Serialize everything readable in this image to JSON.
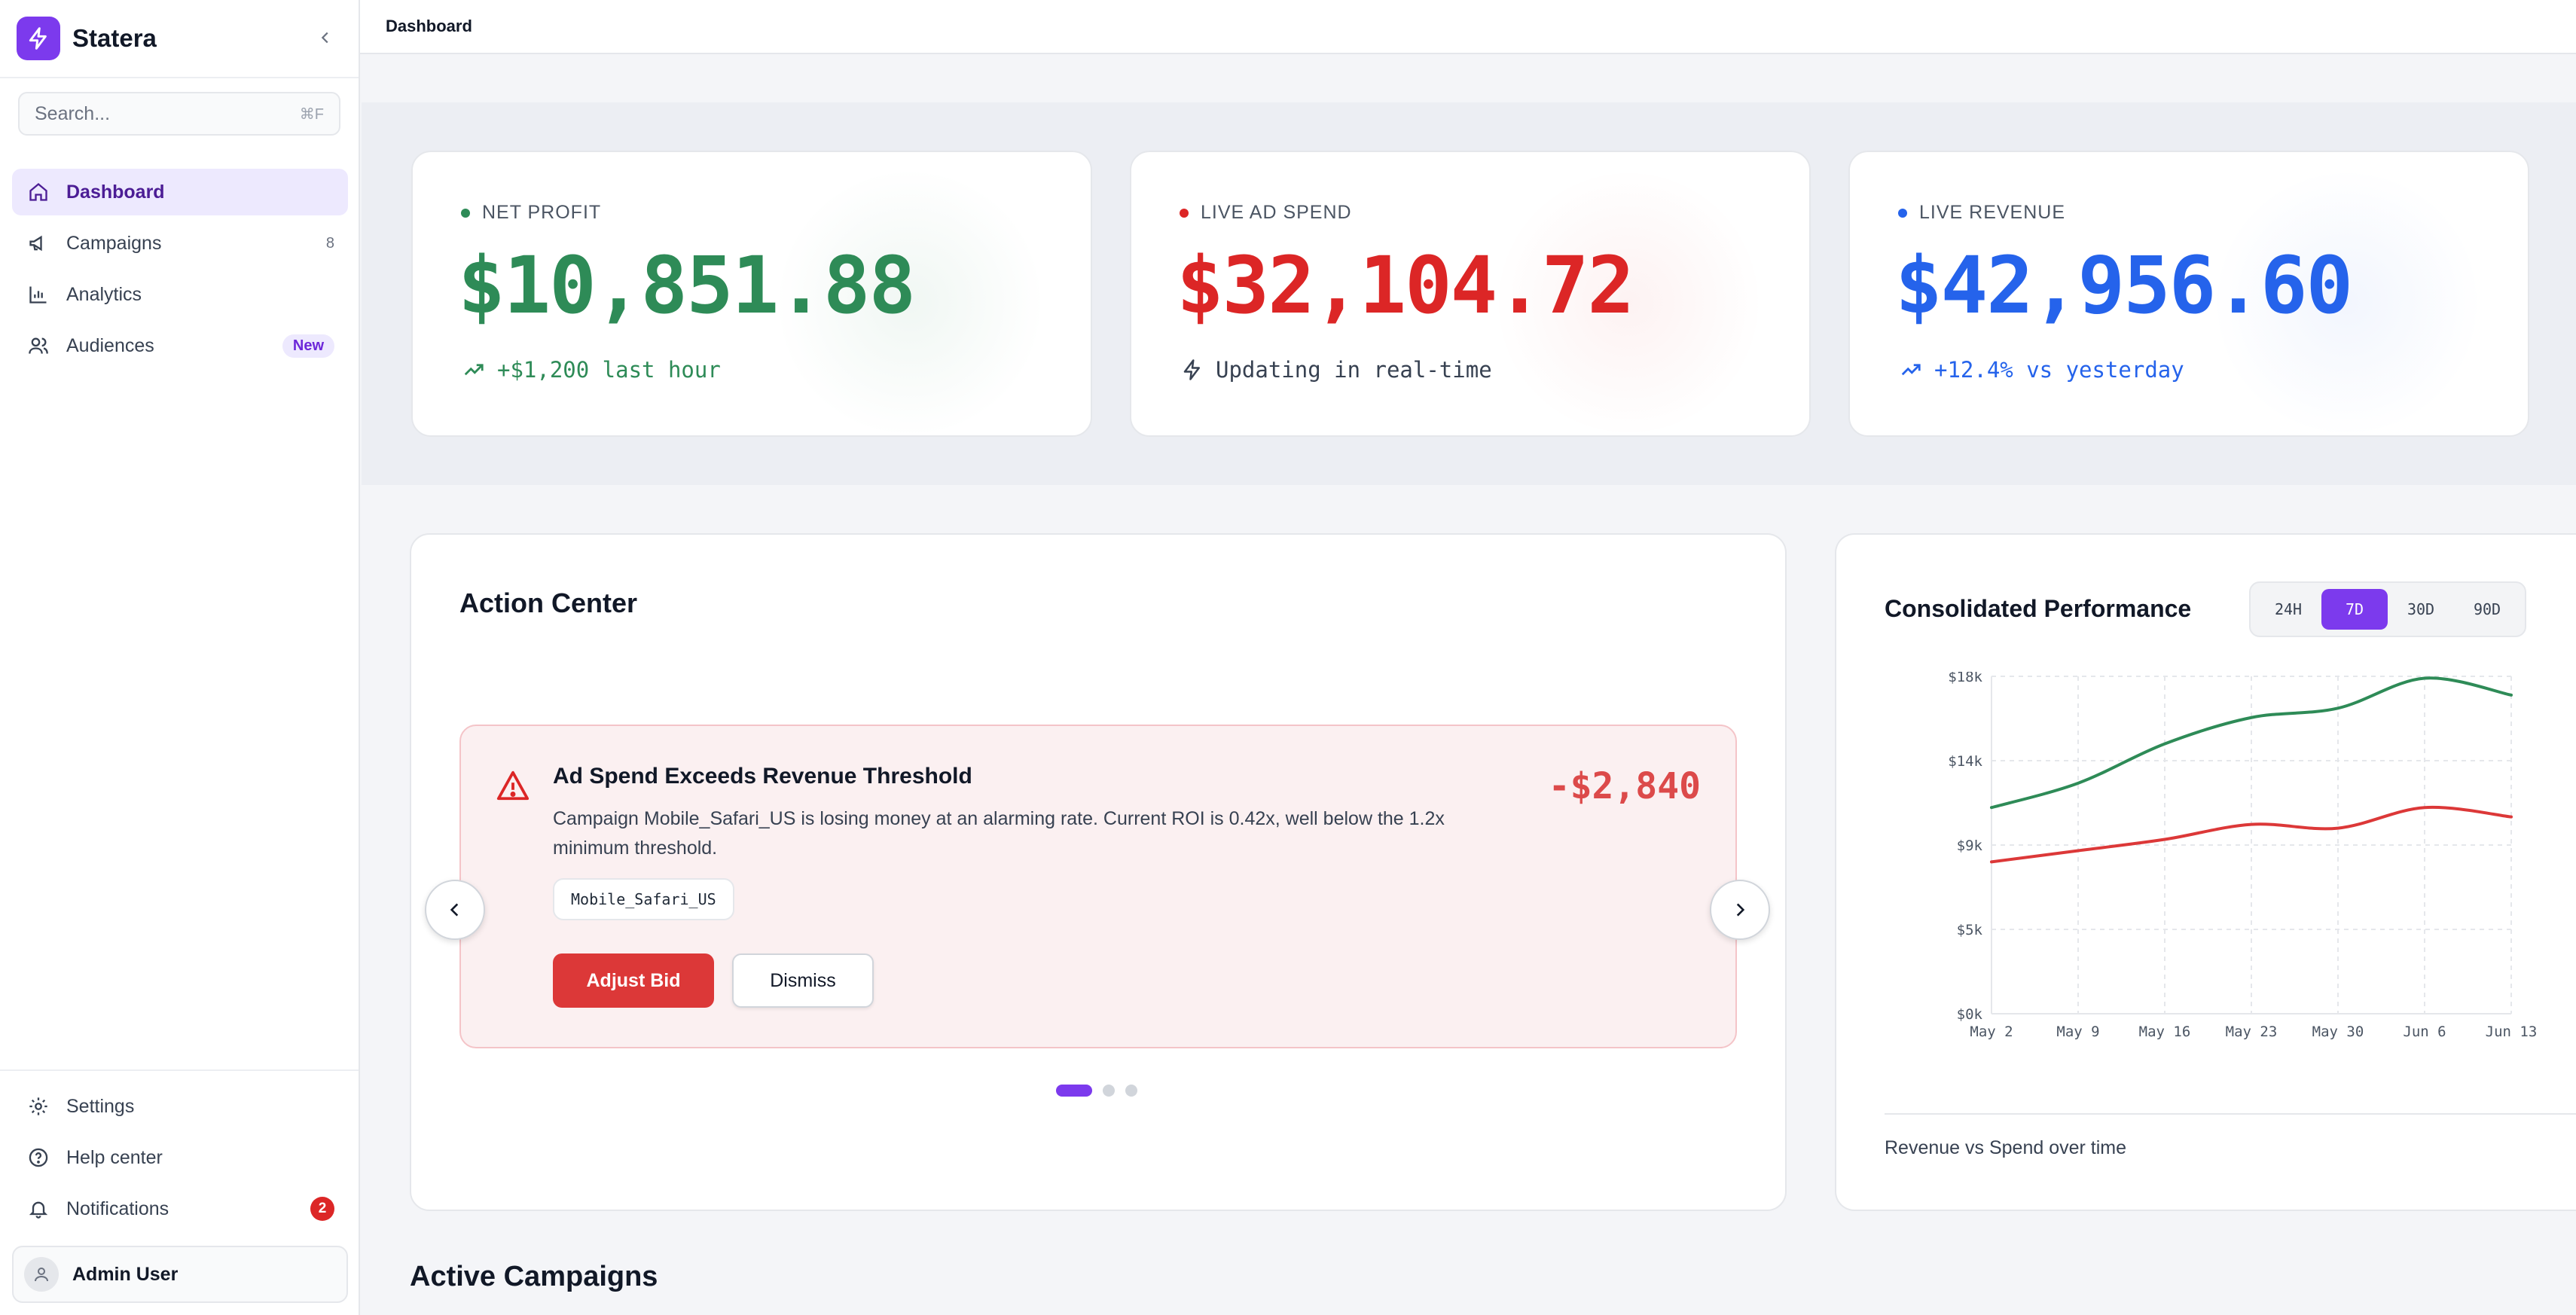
{
  "app": {
    "name": "Statera"
  },
  "search": {
    "placeholder": "Search...",
    "shortcut": "⌘F"
  },
  "nav": [
    {
      "label": "Dashboard",
      "icon": "home-icon",
      "active": true
    },
    {
      "label": "Campaigns",
      "icon": "megaphone-icon",
      "meta": "8"
    },
    {
      "label": "Analytics",
      "icon": "bar-chart-icon"
    },
    {
      "label": "Audiences",
      "icon": "users-icon",
      "badge": "New"
    }
  ],
  "footer_nav": [
    {
      "label": "Settings",
      "icon": "gear-icon"
    },
    {
      "label": "Help center",
      "icon": "help-circle-icon"
    },
    {
      "label": "Notifications",
      "icon": "bell-icon",
      "count": "2"
    }
  ],
  "user": {
    "name": "Admin User"
  },
  "breadcrumb": "Dashboard",
  "colors": {
    "accent": "#7c3aed",
    "profit": "#2e8b57",
    "spend": "#dc2626",
    "revenue": "#2563eb"
  },
  "kpis": [
    {
      "label": "NET PROFIT",
      "value": "$10,851.88",
      "sub": "+$1,200 last hour",
      "icon": "trending-up-icon"
    },
    {
      "label": "LIVE AD SPEND",
      "value": "$32,104.72",
      "sub": "Updating in real-time",
      "icon": "zap-icon"
    },
    {
      "label": "LIVE REVENUE",
      "value": "$42,956.60",
      "sub": "+12.4% vs yesterday",
      "icon": "trending-up-icon"
    }
  ],
  "action_center": {
    "title": "Action Center",
    "alert": {
      "title": "Ad Spend Exceeds Revenue Threshold",
      "body": "Campaign Mobile_Safari_US is losing money at an alarming rate. Current ROI is 0.42x, well below the 1.2x minimum threshold.",
      "amount": "-$2,840",
      "tag": "Mobile_Safari_US",
      "primary_action": "Adjust Bid",
      "secondary_action": "Dismiss"
    },
    "page": 1,
    "pages": 3
  },
  "performance": {
    "title": "Consolidated Performance",
    "ranges": [
      "24H",
      "7D",
      "30D",
      "90D"
    ],
    "selected_range": "7D",
    "caption": "Revenue vs Spend over time"
  },
  "chart_data": {
    "type": "line",
    "x": [
      "May 2",
      "May 9",
      "May 16",
      "May 23",
      "May 30",
      "Jun 6",
      "Jun 13"
    ],
    "y_ticks": [
      "$0k",
      "$5k",
      "$9k",
      "$14k",
      "$18k"
    ],
    "ylim": [
      0,
      18000
    ],
    "grid": true,
    "series": [
      {
        "color": "#2e8b57",
        "values": [
          11000,
          12300,
          14400,
          15800,
          16300,
          17900,
          17000
        ]
      },
      {
        "color": "#dc3838",
        "values": [
          8100,
          8700,
          9300,
          10100,
          9900,
          11000,
          10500
        ]
      }
    ]
  },
  "active_campaigns": {
    "title": "Active Campaigns"
  }
}
